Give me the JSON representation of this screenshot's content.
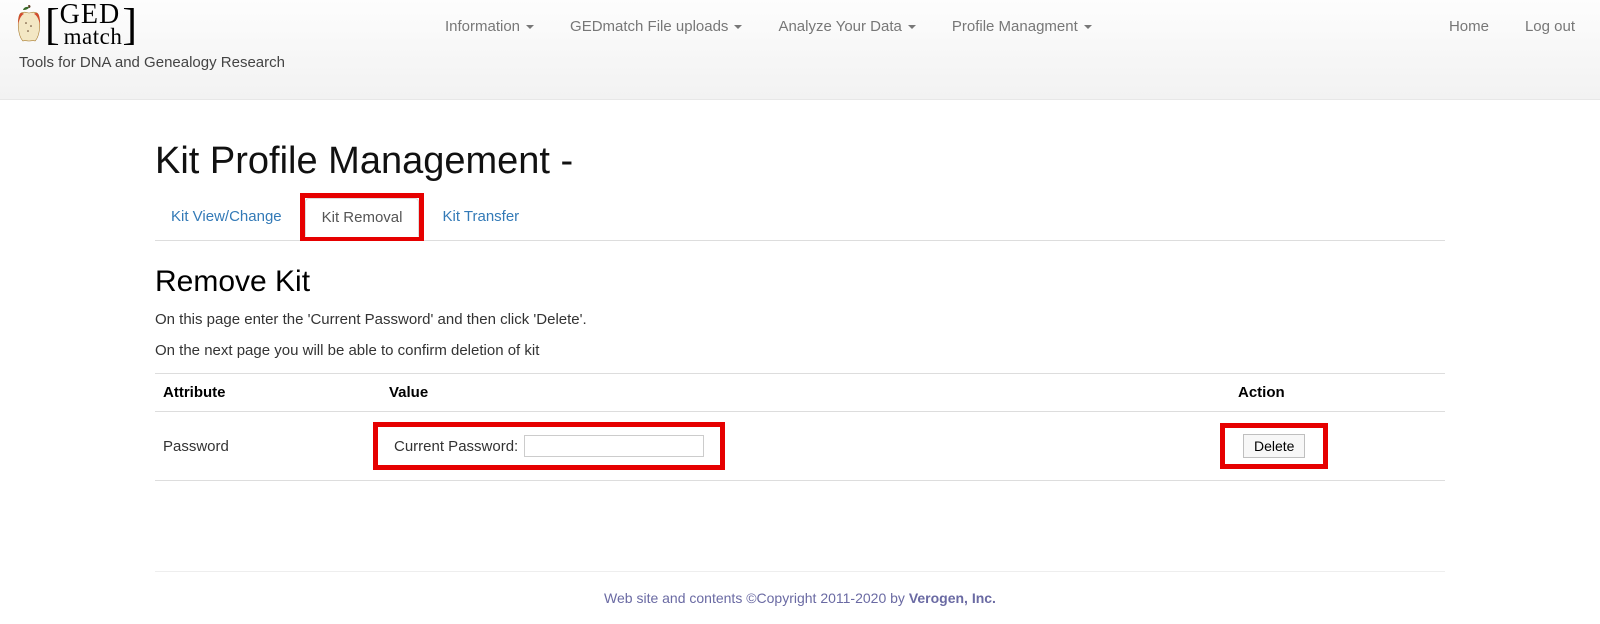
{
  "brand": {
    "ged": "GED",
    "match": "match",
    "tagline": "Tools for DNA and Genealogy Research"
  },
  "nav": {
    "left": [
      {
        "label": "Information",
        "caret": true
      },
      {
        "label": "GEDmatch File uploads",
        "caret": true
      },
      {
        "label": "Analyze Your Data",
        "caret": true
      },
      {
        "label": "Profile Managment",
        "caret": true
      }
    ],
    "right": [
      {
        "label": "Home"
      },
      {
        "label": "Log out"
      }
    ]
  },
  "page": {
    "title": "Kit Profile Management -"
  },
  "subtabs": {
    "items": [
      {
        "label": "Kit View/Change",
        "active": false
      },
      {
        "label": "Kit Removal",
        "active": true
      },
      {
        "label": "Kit Transfer",
        "active": false
      }
    ]
  },
  "section": {
    "heading": "Remove Kit",
    "instruction1": "On this page enter the 'Current Password' and then click 'Delete'.",
    "instruction2": "On the next page you will be able to confirm deletion of kit"
  },
  "table": {
    "headers": {
      "attribute": "Attribute",
      "value": "Value",
      "action": "Action"
    },
    "row": {
      "attribute": "Password",
      "value_label": "Current Password:",
      "action_button": "Delete"
    }
  },
  "footer": {
    "text": "Web site and contents ©Copyright 2011-2020 by ",
    "company": "Verogen, Inc."
  }
}
